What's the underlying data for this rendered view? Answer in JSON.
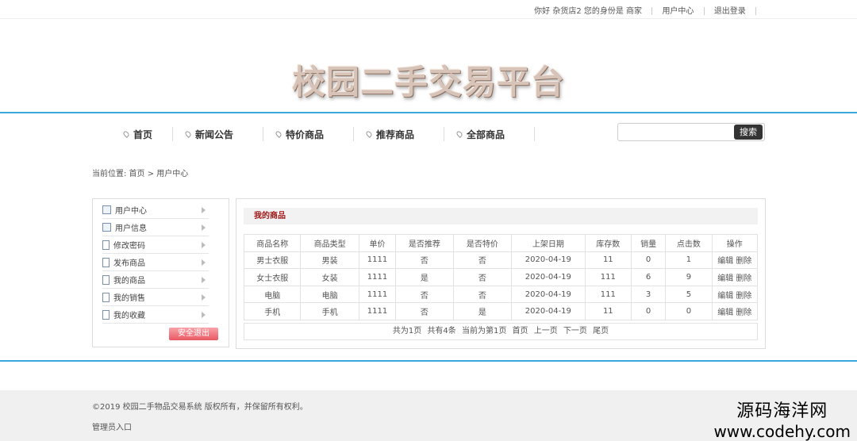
{
  "topbar": {
    "greeting": "你好 杂货店2 您的身份是 商家",
    "user_center": "用户中心",
    "logout": "退出登录"
  },
  "logo": {
    "text": "校园二手交易平台"
  },
  "nav": {
    "items": [
      {
        "label": "首页"
      },
      {
        "label": "新闻公告"
      },
      {
        "label": "特价商品"
      },
      {
        "label": "推荐商品"
      },
      {
        "label": "全部商品"
      }
    ]
  },
  "search": {
    "value": "",
    "button_label": "搜索"
  },
  "breadcrumb": {
    "text": "当前位置: 首页 > 用户中心"
  },
  "sidebar": {
    "items": [
      {
        "label": "用户中心"
      },
      {
        "label": "用户信息"
      },
      {
        "label": "修改密码"
      },
      {
        "label": "发布商品"
      },
      {
        "label": "我的商品"
      },
      {
        "label": "我的销售"
      },
      {
        "label": "我的收藏"
      }
    ],
    "logout_label": "安全退出"
  },
  "main": {
    "title": "我的商品",
    "table": {
      "headers": [
        "商品名称",
        "商品类型",
        "单价",
        "是否推荐",
        "是否特价",
        "上架日期",
        "库存数",
        "销量",
        "点击数",
        "操作"
      ],
      "rows": [
        [
          "男士衣服",
          "男装",
          "1111",
          "否",
          "否",
          "2020-04-19",
          "11",
          "0",
          "1"
        ],
        [
          "女士衣服",
          "女装",
          "1111",
          "是",
          "否",
          "2020-04-19",
          "111",
          "6",
          "9"
        ],
        [
          "电脑",
          "电脑",
          "1111",
          "否",
          "否",
          "2020-04-19",
          "111",
          "3",
          "5"
        ],
        [
          "手机",
          "手机",
          "1111",
          "否",
          "是",
          "2020-04-19",
          "11",
          "0",
          "0"
        ]
      ],
      "edit_label": "编辑",
      "delete_label": "删除"
    },
    "pager": {
      "total_pages": "共为1页",
      "total_items": "共有4条",
      "current": "当前为第1页",
      "first": "首页",
      "prev": "上一页",
      "next": "下一页",
      "last": "尾页"
    }
  },
  "footer": {
    "copyright": "©2019 校园二手物品交易系统 版权所有，并保留所有权利。",
    "admin_link": "管理员入口"
  },
  "watermark": {
    "line1": "源码海洋网",
    "line2": "www.codehy.com"
  },
  "colors": {
    "accent_line": "#3aa7df",
    "title_red": "#a01818",
    "logout_btn": "#ea5863"
  }
}
